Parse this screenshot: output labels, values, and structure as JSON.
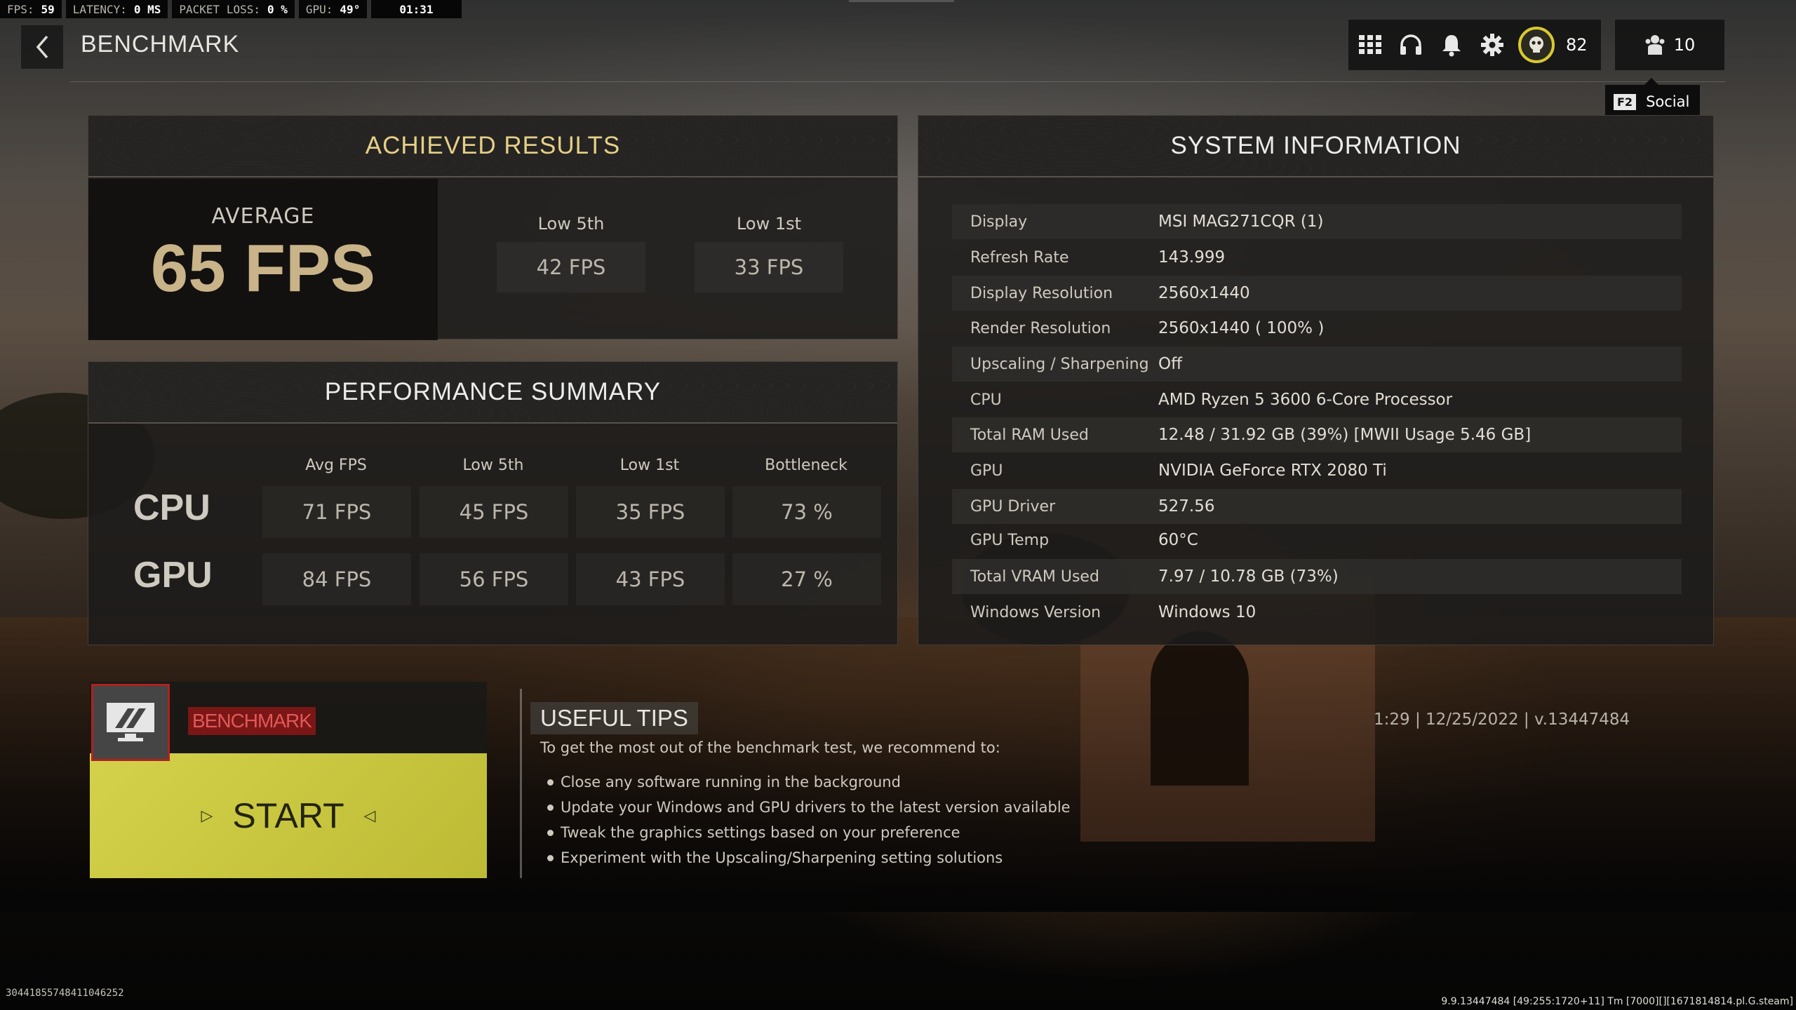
{
  "hud": {
    "fps_label": "FPS:",
    "fps_value": "59",
    "latency_label": "LATENCY:",
    "latency_value": "0 MS",
    "packet_label": "PACKET LOSS:",
    "packet_value": "0 %",
    "gpu_label": "GPU:",
    "gpu_value": "49°",
    "clock": "01:31"
  },
  "header": {
    "title": "BENCHMARK",
    "player_level": "82",
    "social_count": "10",
    "social_key": "F2",
    "social_label": "Social"
  },
  "achieved": {
    "title": "ACHIEVED RESULTS",
    "average_label": "AVERAGE",
    "average_value": "65 FPS",
    "low5_label": "Low 5th",
    "low5_value": "42 FPS",
    "low1_label": "Low 1st",
    "low1_value": "33 FPS"
  },
  "performance": {
    "title": "PERFORMANCE SUMMARY",
    "columns": [
      "Avg FPS",
      "Low 5th",
      "Low 1st",
      "Bottleneck"
    ],
    "rows": [
      {
        "label": "CPU",
        "values": [
          "71 FPS",
          "45 FPS",
          "35 FPS",
          "73 %"
        ]
      },
      {
        "label": "GPU",
        "values": [
          "84 FPS",
          "56 FPS",
          "43 FPS",
          "27 %"
        ]
      }
    ]
  },
  "system": {
    "title": "SYSTEM INFORMATION",
    "rows": [
      {
        "key": "Display",
        "value": "MSI MAG271CQR (1)"
      },
      {
        "key": "Refresh Rate",
        "value": "143.999"
      },
      {
        "key": "Display Resolution",
        "value": "2560x1440"
      },
      {
        "key": "Render Resolution",
        "value": "2560x1440 ( 100% )"
      },
      {
        "key": "Upscaling / Sharpening",
        "value": "Off"
      },
      {
        "key": "CPU",
        "value": "AMD Ryzen 5 3600 6-Core Processor"
      },
      {
        "key": "Total RAM Used",
        "value": "12.48 / 31.92 GB (39%) [MWII Usage 5.46 GB]"
      },
      {
        "key": "GPU",
        "value": "NVIDIA GeForce RTX 2080 Ti"
      },
      {
        "key": "GPU Driver",
        "value": "527.56"
      },
      {
        "key": "GPU Temp",
        "value": "60°C"
      },
      {
        "key": "Total VRAM Used",
        "value": "7.97 / 10.78 GB (73%)"
      },
      {
        "key": "Windows Version",
        "value": "Windows 10"
      }
    ]
  },
  "benchmark_card": {
    "tag": "BENCHMARK",
    "start_label": "START"
  },
  "tips": {
    "title": "USEFUL TIPS",
    "intro": "To get the most out of the benchmark test, we recommend to:",
    "items": [
      "Close any software running in the background",
      "Update your Windows and GPU drivers to the latest version available",
      "Tweak the graphics settings based on your preference",
      "Experiment with the Upscaling/Sharpening setting solutions"
    ]
  },
  "version_info": "1:29 | 12/25/2022 | v.13447484",
  "footer": {
    "left": "30441855748411046252",
    "right": "9.9.13447484 [49:255:1720+11] Tm [7000][][1671814814.pl.G.steam]"
  },
  "colors": {
    "accent_gold": "#e6cf87",
    "start_yellow": "#d4d24a",
    "benchmark_red": "#b02121",
    "level_ring": "#d9c92e"
  }
}
